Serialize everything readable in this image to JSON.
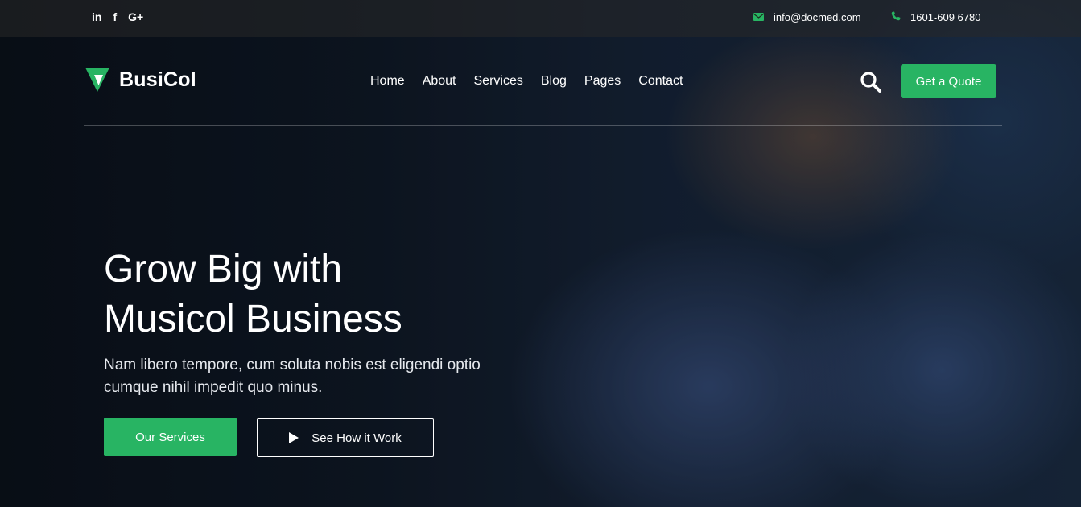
{
  "topbar": {
    "social": [
      {
        "icon": "linkedin-icon",
        "glyph": "in"
      },
      {
        "icon": "facebook-icon",
        "glyph": "f"
      },
      {
        "icon": "google-plus-icon",
        "glyph": "G+"
      }
    ],
    "email": "info@docmed.com",
    "phone": "1601-609 6780"
  },
  "brand": {
    "name": "BusiCol"
  },
  "nav": {
    "items": [
      {
        "label": "Home"
      },
      {
        "label": "About"
      },
      {
        "label": "Services"
      },
      {
        "label": "Blog"
      },
      {
        "label": "Pages"
      },
      {
        "label": "Contact"
      }
    ],
    "quote_label": "Get a Quote"
  },
  "hero": {
    "title_line1": "Grow Big with",
    "title_line2": "Musicol Business",
    "description": "Nam libero tempore, cum soluta nobis est eligendi optio cumque nihil impedit quo minus.",
    "primary_button": "Our Services",
    "secondary_button": "See How it Work"
  },
  "colors": {
    "accent": "#28b463",
    "topbar_bg": "rgba(40,40,40,0.55)"
  }
}
